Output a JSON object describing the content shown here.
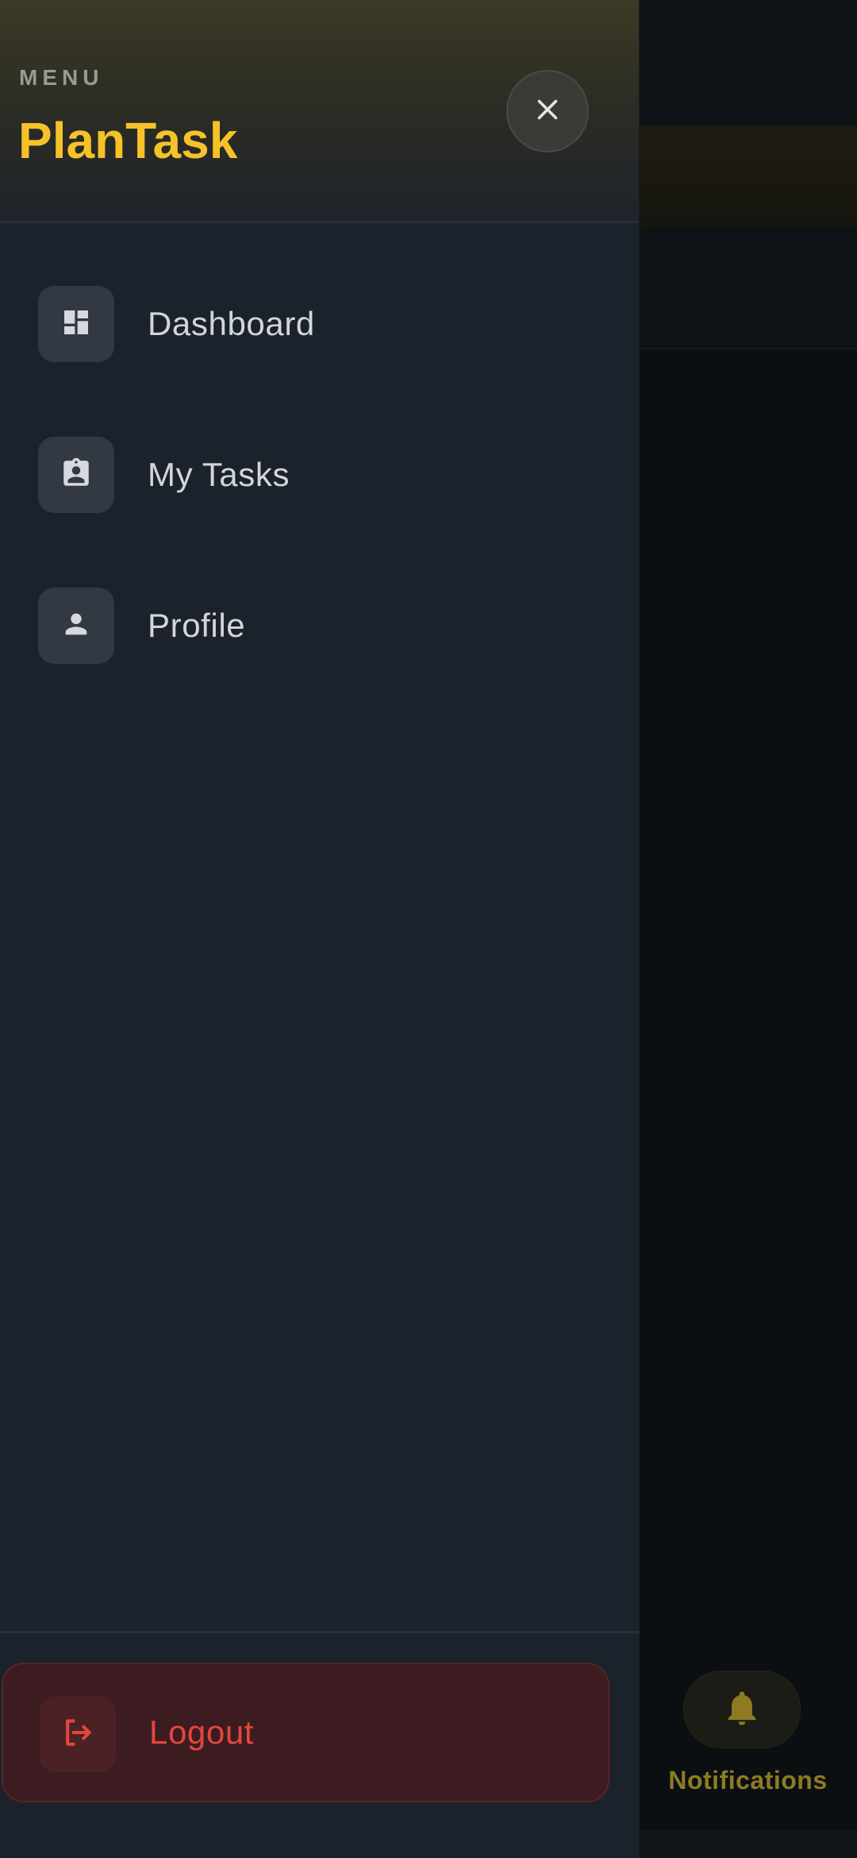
{
  "drawer": {
    "caption": "MENU",
    "app_title": "PlanTask",
    "close_icon": "close-icon",
    "items": [
      {
        "label": "Dashboard",
        "icon": "dashboard-icon"
      },
      {
        "label": "My Tasks",
        "icon": "assignment-icon"
      },
      {
        "label": "Profile",
        "icon": "person-icon"
      }
    ],
    "logout": {
      "label": "Logout",
      "icon": "logout-icon"
    }
  },
  "bottom_nav": {
    "notifications": {
      "label": "Notifications",
      "icon": "bell-icon"
    }
  },
  "colors": {
    "accent": "#f5c228",
    "drawer_bg": "#1c222b",
    "danger": "#e2473d"
  }
}
